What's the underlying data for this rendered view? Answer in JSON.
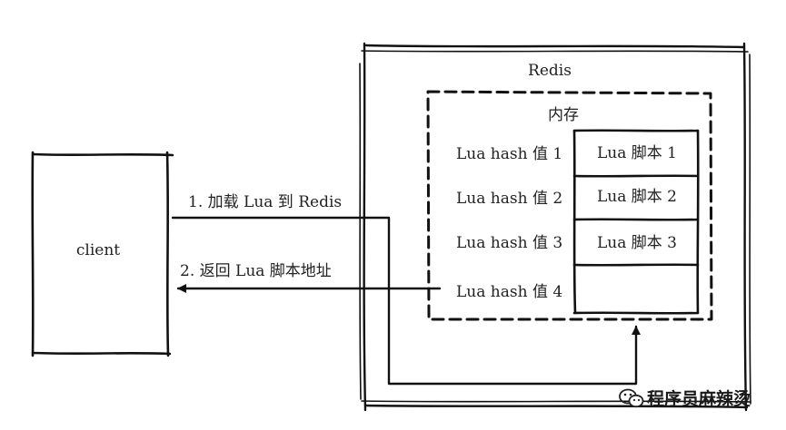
{
  "client": {
    "label": "client"
  },
  "redis": {
    "label": "Redis",
    "memory": {
      "label": "内存",
      "rows": [
        {
          "hash": "Lua hash 值 1",
          "script": "Lua 脚本 1"
        },
        {
          "hash": "Lua hash 值 2",
          "script": "Lua 脚本 2"
        },
        {
          "hash": "Lua hash 值 3",
          "script": "Lua 脚本 3"
        },
        {
          "hash": "Lua hash 值 4",
          "script": ""
        }
      ]
    }
  },
  "arrows": {
    "load": "1. 加载 Lua 到 Redis",
    "return": "2. 返回 Lua 脚本地址"
  },
  "watermark": {
    "text": "程序员麻辣烫"
  }
}
